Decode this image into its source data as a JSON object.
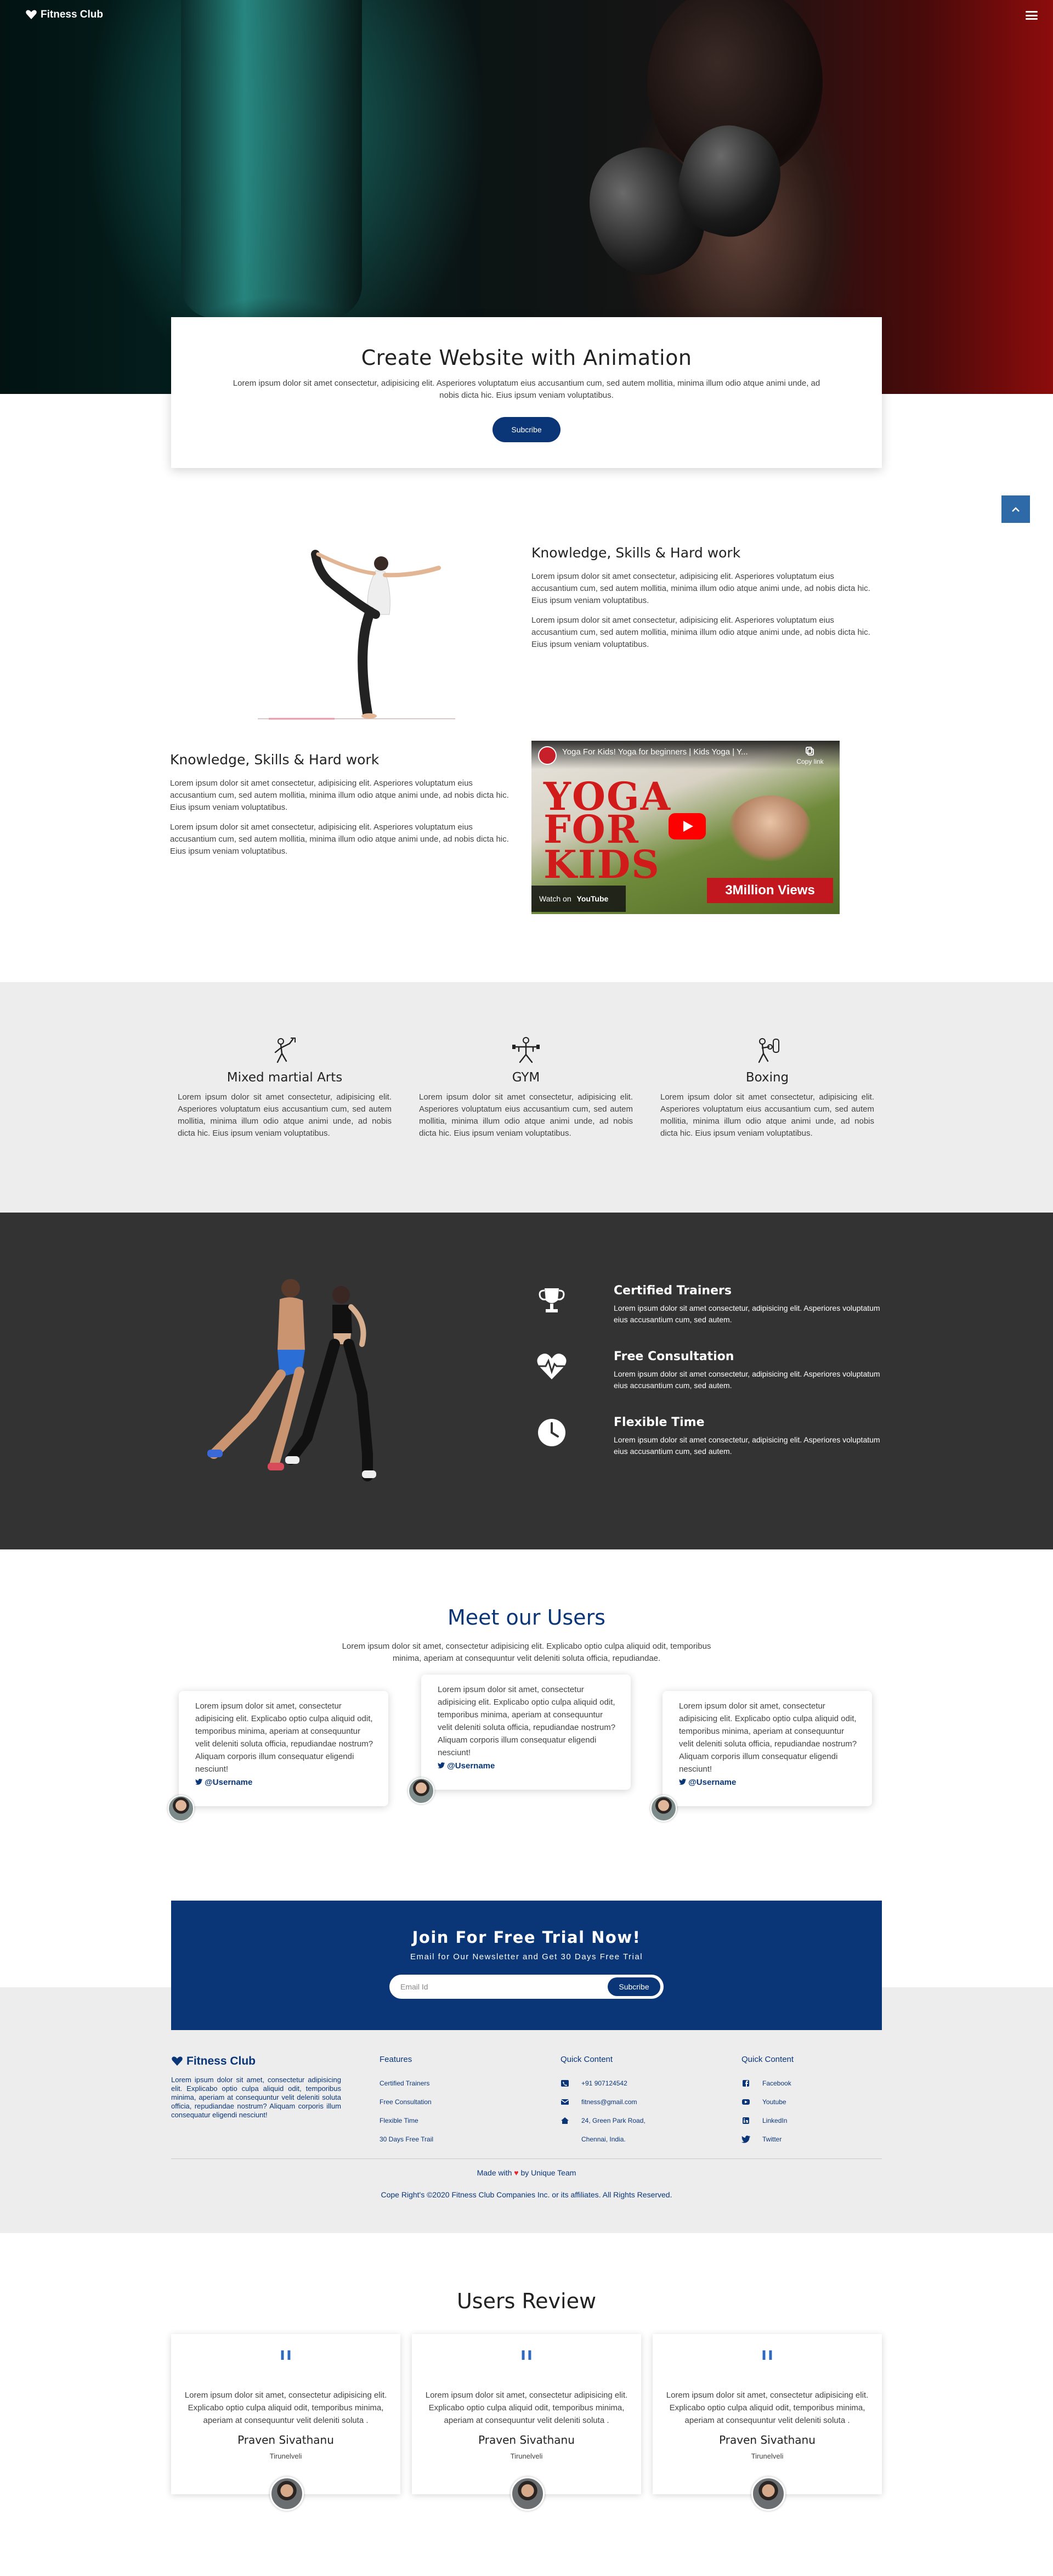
{
  "nav": {
    "brand": "Fitness Club"
  },
  "hero": {
    "title": "Create Website with Animation",
    "text": "Lorem ipsum dolor sit amet consectetur, adipisicing elit. Asperiores voluptatum eius accusantium cum, sed autem mollitia, minima illum odio atque animi unde, ad nobis dicta hic. Eius ipsum veniam voluptatibus.",
    "button": "Subcribe"
  },
  "scroll_top_icon": "chevron-up-icon",
  "features": [
    {
      "title": "Knowledge, Skills & Hard work",
      "p1": "Lorem ipsum dolor sit amet consectetur, adipisicing elit. Asperiores voluptatum eius accusantium cum, sed autem mollitia, minima illum odio atque animi unde, ad nobis dicta hic. Eius ipsum veniam voluptatibus.",
      "p2": "Lorem ipsum dolor sit amet consectetur, adipisicing elit. Asperiores voluptatum eius accusantium cum, sed autem mollitia, minima illum odio atque animi unde, ad nobis dicta hic. Eius ipsum veniam voluptatibus."
    },
    {
      "title": "Knowledge, Skills & Hard work",
      "p1": "Lorem ipsum dolor sit amet consectetur, adipisicing elit. Asperiores voluptatum eius accusantium cum, sed autem mollitia, minima illum odio atque animi unde, ad nobis dicta hic. Eius ipsum veniam voluptatibus.",
      "p2": "Lorem ipsum dolor sit amet consectetur, adipisicing elit. Asperiores voluptatum eius accusantium cum, sed autem mollitia, minima illum odio atque animi unde, ad nobis dicta hic. Eius ipsum veniam voluptatibus."
    }
  ],
  "video": {
    "title": "Yoga For Kids! Yoga for beginners | Kids Yoga | Y...",
    "copy_link": "Copy link",
    "thumb_lines": [
      "YOGA",
      "FOR",
      "KIDS"
    ],
    "views": "3Million Views",
    "watch_on": "Watch on",
    "yt": "YouTube"
  },
  "services": [
    {
      "icon": "martial-arts-icon",
      "title": "Mixed martial Arts",
      "text": "Lorem ipsum dolor sit amet consectetur, adipisicing elit. Asperiores voluptatum eius accusantium cum, sed autem mollitia, minima illum odio atque animi unde, ad nobis dicta hic. Eius ipsum veniam voluptatibus."
    },
    {
      "icon": "gym-icon",
      "title": "GYM",
      "text": "Lorem ipsum dolor sit amet consectetur, adipisicing elit. Asperiores voluptatum eius accusantium cum, sed autem mollitia, minima illum odio atque animi unde, ad nobis dicta hic. Eius ipsum veniam voluptatibus."
    },
    {
      "icon": "boxing-icon",
      "title": "Boxing",
      "text": "Lorem ipsum dolor sit amet consectetur, adipisicing elit. Asperiores voluptatum eius accusantium cum, sed autem mollitia, minima illum odio atque animi unde, ad nobis dicta hic. Eius ipsum veniam voluptatibus."
    }
  ],
  "benefits": [
    {
      "icon": "trophy-icon",
      "title": "Certified Trainers",
      "text": "Lorem ipsum dolor sit amet consectetur, adipisicing elit. Asperiores voluptatum eius accusantium cum, sed autem."
    },
    {
      "icon": "heartbeat-icon",
      "title": "Free Consultation",
      "text": "Lorem ipsum dolor sit amet consectetur, adipisicing elit. Asperiores voluptatum eius accusantium cum, sed autem."
    },
    {
      "icon": "clock-icon",
      "title": "Flexible Time",
      "text": "Lorem ipsum dolor sit amet consectetur, adipisicing elit. Asperiores voluptatum eius accusantium cum, sed autem."
    }
  ],
  "users": {
    "title": "Meet our Users",
    "text": "Lorem ipsum dolor sit amet, consectetur adipisicing elit. Explicabo optio culpa aliquid odit, temporibus minima, aperiam at consequuntur velit deleniti soluta officia, repudiandae.",
    "cards": [
      {
        "text": "Lorem ipsum dolor sit amet, consectetur adipisicing elit. Explicabo optio culpa aliquid odit, temporibus minima, aperiam at consequuntur velit deleniti soluta officia, repudiandae nostrum? Aliquam corporis illum consequatur eligendi nesciunt!",
        "handle": "@Username"
      },
      {
        "text": "Lorem ipsum dolor sit amet, consectetur adipisicing elit. Explicabo optio culpa aliquid odit, temporibus minima, aperiam at consequuntur velit deleniti soluta officia, repudiandae nostrum? Aliquam corporis illum consequatur eligendi nesciunt!",
        "handle": "@Username"
      },
      {
        "text": "Lorem ipsum dolor sit amet, consectetur adipisicing elit. Explicabo optio culpa aliquid odit, temporibus minima, aperiam at consequuntur velit deleniti soluta officia, repudiandae nostrum? Aliquam corporis illum consequatur eligendi nesciunt!",
        "handle": "@Username"
      }
    ]
  },
  "newsletter": {
    "title": "Join For Free Trial Now!",
    "subtitle": "Email for Our Newsletter and Get 30 Days Free Trial",
    "placeholder": "Email Id",
    "button": "Subcribe"
  },
  "footer": {
    "brand": "Fitness Club",
    "about": "Lorem ipsum dolor sit amet, consectetur adipisicing elit. Explicabo optio culpa aliquid odit, temporibus minima, aperiam at consequuntur velit deleniti soluta officia, repudiandae nostrum? Aliquam corporis illum consequatur eligendi nesciunt!",
    "features_title": "Features",
    "features": [
      "Certified Trainers",
      "Free Consultation",
      "Flexible Time",
      "30 Days Free Trail"
    ],
    "contact_title": "Quick Content",
    "contact": [
      {
        "icon": "phone-icon",
        "text": "+91 907124542"
      },
      {
        "icon": "mail-icon",
        "text": "fitness@gmail.com"
      },
      {
        "icon": "home-icon",
        "text": "24, Green Park Road,"
      },
      {
        "icon": "",
        "text": "Chennai, India."
      }
    ],
    "social_title": "Quick Content",
    "social": [
      {
        "icon": "facebook-icon",
        "text": "Facebook"
      },
      {
        "icon": "youtube-icon",
        "text": "Youtube"
      },
      {
        "icon": "linkedin-icon",
        "text": "LinkedIn"
      },
      {
        "icon": "twitter-icon",
        "text": "Twitter"
      }
    ],
    "made_prefix": "Made with",
    "made_suffix": "by Unique Team",
    "copyright": "Cope Right's ©2020 Fitness Club Companies Inc. or its affiliates. All Rights Reserved."
  },
  "reviews": {
    "title": "Users Review",
    "items": [
      {
        "text": "Lorem ipsum dolor sit amet, consectetur adipisicing elit. Explicabo optio culpa aliquid odit, temporibus minima, aperiam at consequuntur velit deleniti soluta .",
        "name": "Praven Sivathanu",
        "city": "Tirunelveli"
      },
      {
        "text": "Lorem ipsum dolor sit amet, consectetur adipisicing elit. Explicabo optio culpa aliquid odit, temporibus minima, aperiam at consequuntur velit deleniti soluta .",
        "name": "Praven Sivathanu",
        "city": "Tirunelveli"
      },
      {
        "text": "Lorem ipsum dolor sit amet, consectetur adipisicing elit. Explicabo optio culpa aliquid odit, temporibus minima, aperiam at consequuntur velit deleniti soluta .",
        "name": "Praven Sivathanu",
        "city": "Tirunelveli"
      }
    ]
  },
  "colors": {
    "primary": "#0a3577",
    "accent_red": "#e3262c",
    "dark_bg": "#333333",
    "light_bg": "#ededed"
  }
}
